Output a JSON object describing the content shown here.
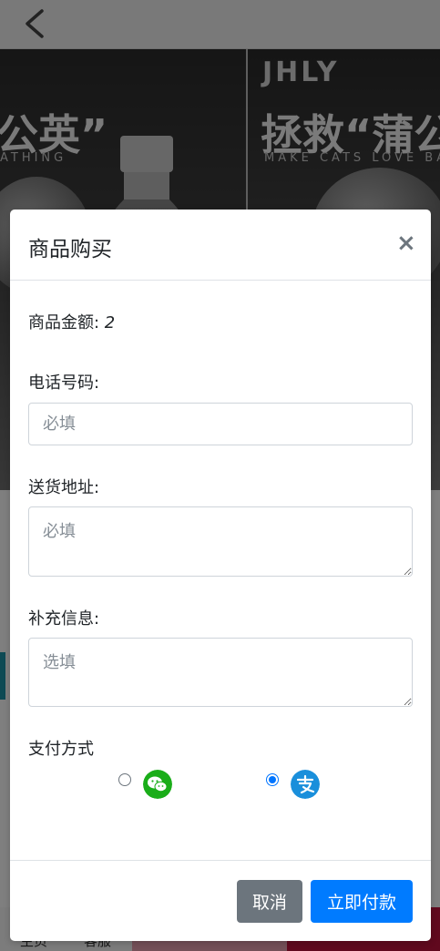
{
  "page": {
    "banner_left_title": "公英”",
    "banner_left_sub": "ATHING",
    "banner_right_brand": "JHLY",
    "banner_right_title": "拯救“蒲公",
    "banner_right_sub": "MAKE CATS LOVE BA"
  },
  "bottom_nav": {
    "item1": "主页",
    "item2": "客服"
  },
  "modal": {
    "title": "商品购买",
    "close_symbol": "×",
    "price_label": "商品金额: ",
    "price_value": "2",
    "phone_label": "电话号码:",
    "phone_placeholder": "必填",
    "address_label": "送货地址:",
    "address_placeholder": "必填",
    "extra_label": "补充信息:",
    "extra_placeholder": "选填",
    "payment_label": "支付方式",
    "payment_options": [
      {
        "icon": "wechat-pay-icon",
        "selected": false,
        "color": "#1aad19"
      },
      {
        "icon": "alipay-icon",
        "selected": true,
        "color": "#1a8fdb"
      }
    ],
    "cancel_label": "取消",
    "pay_label": "立即付款"
  }
}
